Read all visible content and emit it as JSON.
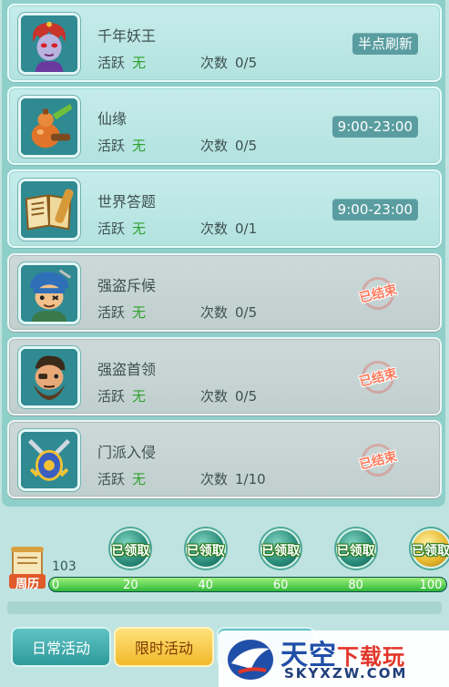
{
  "events": [
    {
      "name": "千年妖王",
      "active_label": "活跃",
      "active_value": "无",
      "count_label": "次数",
      "count_value": "0/5",
      "status_type": "time",
      "status_text": "半点刷新",
      "avatar": "demon-king-portrait"
    },
    {
      "name": "仙缘",
      "active_label": "活跃",
      "active_value": "无",
      "count_label": "次数",
      "count_value": "0/5",
      "status_type": "time",
      "status_text": "9:00-23:00",
      "avatar": "gourd-portrait"
    },
    {
      "name": "世界答题",
      "active_label": "活跃",
      "active_value": "无",
      "count_label": "次数",
      "count_value": "0/1",
      "status_type": "time",
      "status_text": "9:00-23:00",
      "avatar": "book-scroll-portrait"
    },
    {
      "name": "强盗斥候",
      "active_label": "活跃",
      "active_value": "无",
      "count_label": "次数",
      "count_value": "0/5",
      "status_type": "ended",
      "status_text": "已结束",
      "avatar": "bandit-scout-portrait"
    },
    {
      "name": "强盗首领",
      "active_label": "活跃",
      "active_value": "无",
      "count_label": "次数",
      "count_value": "0/5",
      "status_type": "ended",
      "status_text": "已结束",
      "avatar": "bandit-chief-portrait"
    },
    {
      "name": "门派入侵",
      "active_label": "活跃",
      "active_value": "无",
      "count_label": "次数",
      "count_value": "1/10",
      "status_type": "ended",
      "status_text": "已结束",
      "avatar": "crossed-swords-portrait"
    }
  ],
  "progress": {
    "calendar_label": "周历",
    "current_value": "103",
    "max": 100,
    "fill_fraction": 1.0,
    "ticks": [
      "0",
      "20",
      "40",
      "60",
      "80",
      "100"
    ],
    "rewards": [
      {
        "threshold": 20,
        "label": "已领取"
      },
      {
        "threshold": 40,
        "label": "已领取"
      },
      {
        "threshold": 60,
        "label": "已领取"
      },
      {
        "threshold": 80,
        "label": "已领取"
      },
      {
        "threshold": 100,
        "label": "已领取"
      }
    ]
  },
  "tabs": {
    "daily": "日常活动",
    "limited": "限时活动"
  },
  "watermark": {
    "title_main": "天空",
    "title_accent": "下载玩",
    "url": "SKYXZW.COM"
  },
  "colors": {
    "active_value": "#2fa12f",
    "time_badge": "#5a9da0",
    "ended_stamp": "#ff7a5c",
    "progress_fill": "#2fb83a"
  }
}
